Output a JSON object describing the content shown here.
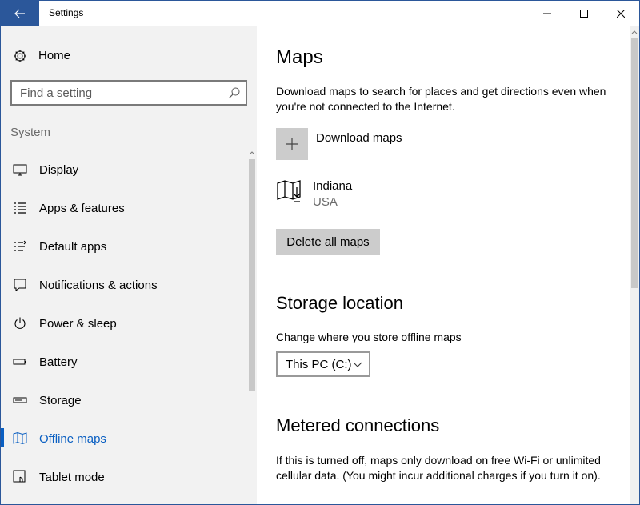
{
  "window": {
    "title": "Settings"
  },
  "nav": {
    "home_label": "Home",
    "search_placeholder": "Find a setting",
    "section_label": "System",
    "items": [
      {
        "label": "Display",
        "icon": "display-icon"
      },
      {
        "label": "Apps & features",
        "icon": "apps-list-icon"
      },
      {
        "label": "Default apps",
        "icon": "default-apps-icon"
      },
      {
        "label": "Notifications & actions",
        "icon": "notifications-icon"
      },
      {
        "label": "Power & sleep",
        "icon": "power-icon"
      },
      {
        "label": "Battery",
        "icon": "battery-icon"
      },
      {
        "label": "Storage",
        "icon": "storage-icon"
      },
      {
        "label": "Offline maps",
        "icon": "map-icon",
        "active": true
      },
      {
        "label": "Tablet mode",
        "icon": "tablet-mode-icon"
      }
    ]
  },
  "main": {
    "title": "Maps",
    "description": "Download maps to search for places and get directions even when you're not connected to the Internet.",
    "download_label": "Download maps",
    "map_entry": {
      "name": "Indiana",
      "region": "USA"
    },
    "delete_all_label": "Delete all maps",
    "storage": {
      "heading": "Storage location",
      "label": "Change where you store offline maps",
      "selected": "This PC (C:)"
    },
    "metered": {
      "heading": "Metered connections",
      "description": "If this is turned off, maps only download on free Wi-Fi or unlimited cellular data. (You might incur additional charges if you turn it on)."
    }
  },
  "colors": {
    "accent": "#0a5fc2",
    "titlebar_back": "#2b579a",
    "nav_bg": "#f2f2f2",
    "button_gray": "#cccccc"
  }
}
